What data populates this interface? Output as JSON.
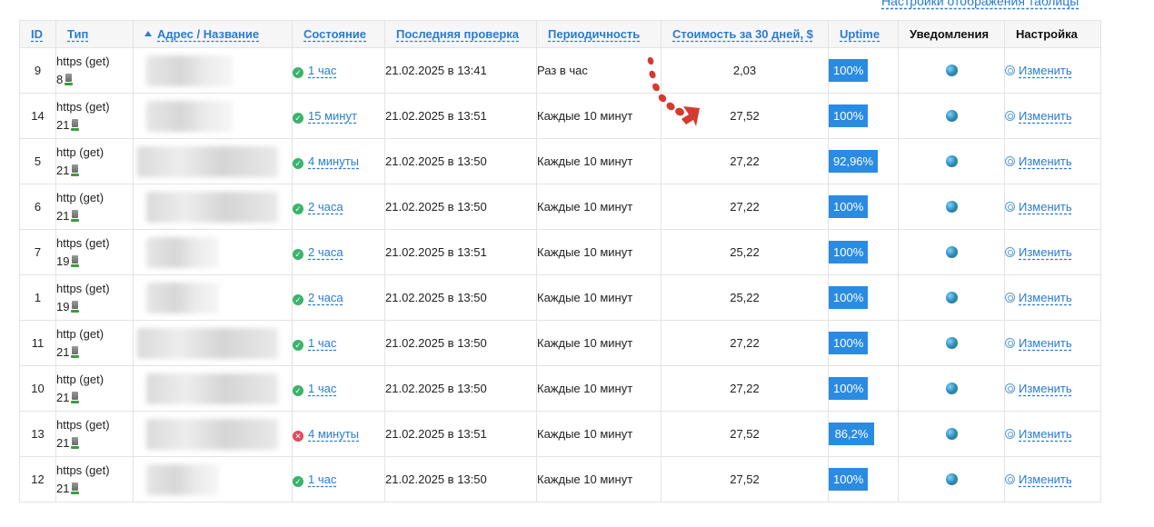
{
  "table_settings_link": "Настройки отображения таблицы",
  "columns": {
    "id": "ID",
    "type": "Тип",
    "address": "Адрес / Название",
    "status": "Состояние",
    "last_check": "Последняя проверка",
    "period": "Периодичность",
    "cost": "Стоимость за 30 дней, $",
    "uptime": "Uptime",
    "notifications": "Уведомления",
    "settings": "Настройка"
  },
  "sort": {
    "column": "address",
    "direction": "asc"
  },
  "edit_label": "Изменить",
  "rows": [
    {
      "id": "9",
      "type": "https (get)",
      "count": "8",
      "status": "ok",
      "status_text": "1 час",
      "last_check": "21.02.2025 в 13:41",
      "period": "Раз в час",
      "cost": "2,03",
      "uptime": "100%"
    },
    {
      "id": "14",
      "type": "https (get)",
      "count": "21",
      "status": "ok",
      "status_text": "15 минут",
      "last_check": "21.02.2025 в 13:51",
      "period": "Каждые 10 минут",
      "cost": "27,52",
      "uptime": "100%"
    },
    {
      "id": "5",
      "type": "http (get)",
      "count": "21",
      "status": "ok",
      "status_text": "4 минуты",
      "last_check": "21.02.2025 в 13:50",
      "period": "Каждые 10 минут",
      "cost": "27,22",
      "uptime": "92,96%"
    },
    {
      "id": "6",
      "type": "http (get)",
      "count": "21",
      "status": "ok",
      "status_text": "2 часа",
      "last_check": "21.02.2025 в 13:50",
      "period": "Каждые 10 минут",
      "cost": "27,22",
      "uptime": "100%"
    },
    {
      "id": "7",
      "type": "https (get)",
      "count": "19",
      "status": "ok",
      "status_text": "2 часа",
      "last_check": "21.02.2025 в 13:51",
      "period": "Каждые 10 минут",
      "cost": "25,22",
      "uptime": "100%"
    },
    {
      "id": "1",
      "type": "https (get)",
      "count": "19",
      "status": "ok",
      "status_text": "2 часа",
      "last_check": "21.02.2025 в 13:50",
      "period": "Каждые 10 минут",
      "cost": "25,22",
      "uptime": "100%"
    },
    {
      "id": "11",
      "type": "http (get)",
      "count": "21",
      "status": "ok",
      "status_text": "1 час",
      "last_check": "21.02.2025 в 13:50",
      "period": "Каждые 10 минут",
      "cost": "27,22",
      "uptime": "100%"
    },
    {
      "id": "10",
      "type": "http (get)",
      "count": "21",
      "status": "ok",
      "status_text": "1 час",
      "last_check": "21.02.2025 в 13:50",
      "period": "Каждые 10 минут",
      "cost": "27,22",
      "uptime": "100%"
    },
    {
      "id": "13",
      "type": "https (get)",
      "count": "21",
      "status": "error",
      "status_text": "4 минуты",
      "last_check": "21.02.2025 в 13:51",
      "period": "Каждые 10 минут",
      "cost": "27,52",
      "uptime": "86,2%"
    },
    {
      "id": "12",
      "type": "https (get)",
      "count": "21",
      "status": "ok",
      "status_text": "1 час",
      "last_check": "21.02.2025 в 13:50",
      "period": "Каждые 10 минут",
      "cost": "27,52",
      "uptime": "100%"
    }
  ],
  "colors": {
    "link": "#2a7bd4",
    "uptime_badge": "#2a8be3",
    "status_ok": "#3bb36a",
    "status_error": "#e0495a",
    "annotation_arrow": "#d63a2f"
  },
  "icons": [
    "sort-asc-icon",
    "server-icon",
    "status-ok-icon",
    "status-error-icon",
    "globe-icon",
    "gear-icon"
  ]
}
